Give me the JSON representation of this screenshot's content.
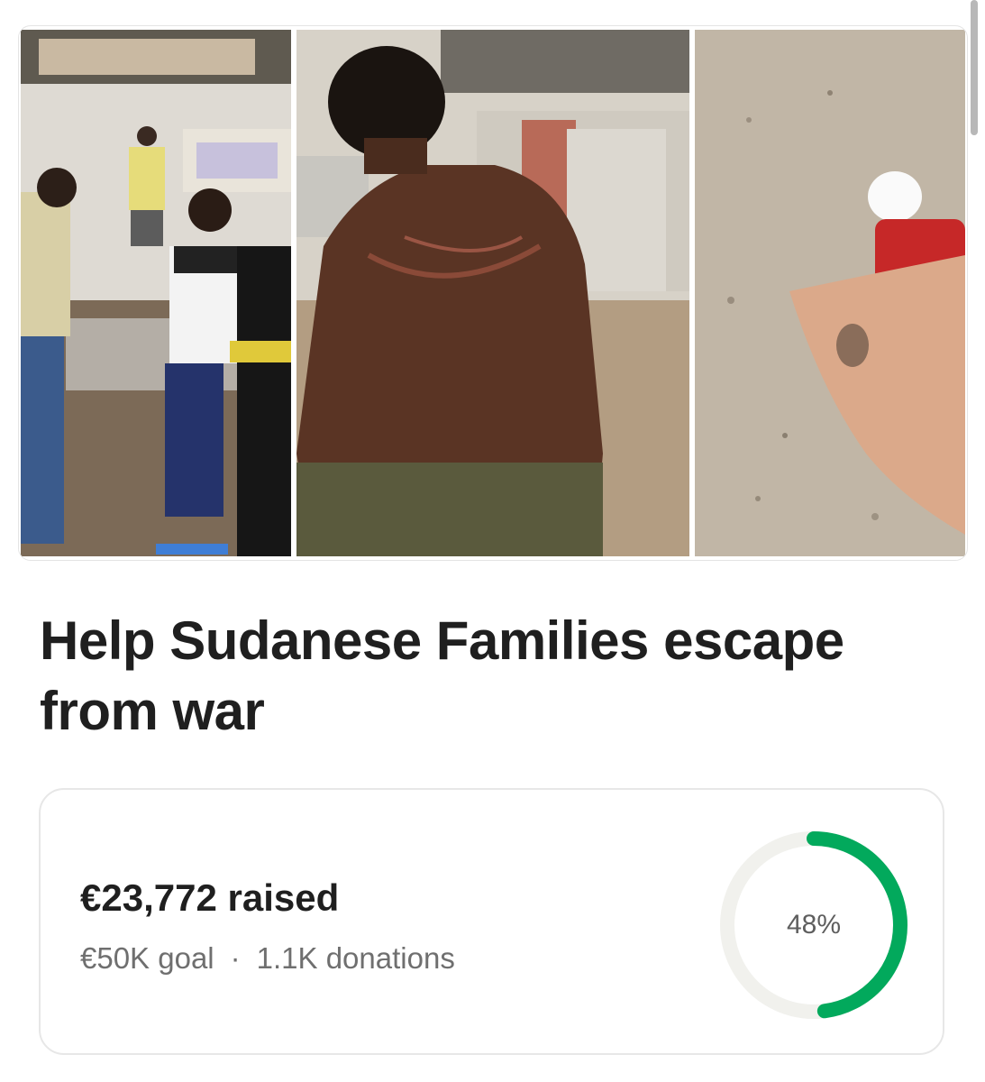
{
  "campaign": {
    "title": "Help Sudanese Families escape from war",
    "photos": [
      {
        "icon": "photo-people-outside-building"
      },
      {
        "icon": "photo-man-back-injury"
      },
      {
        "icon": "photo-person-lying-on-ground"
      }
    ]
  },
  "donation": {
    "raised": "€23,772 raised",
    "goal": "€50K goal",
    "separator": "·",
    "donations": "1.1K donations",
    "percent_label": "48%",
    "progress": 0.48,
    "accent_color": "#02a95c",
    "track_color": "#f1f1ed"
  }
}
